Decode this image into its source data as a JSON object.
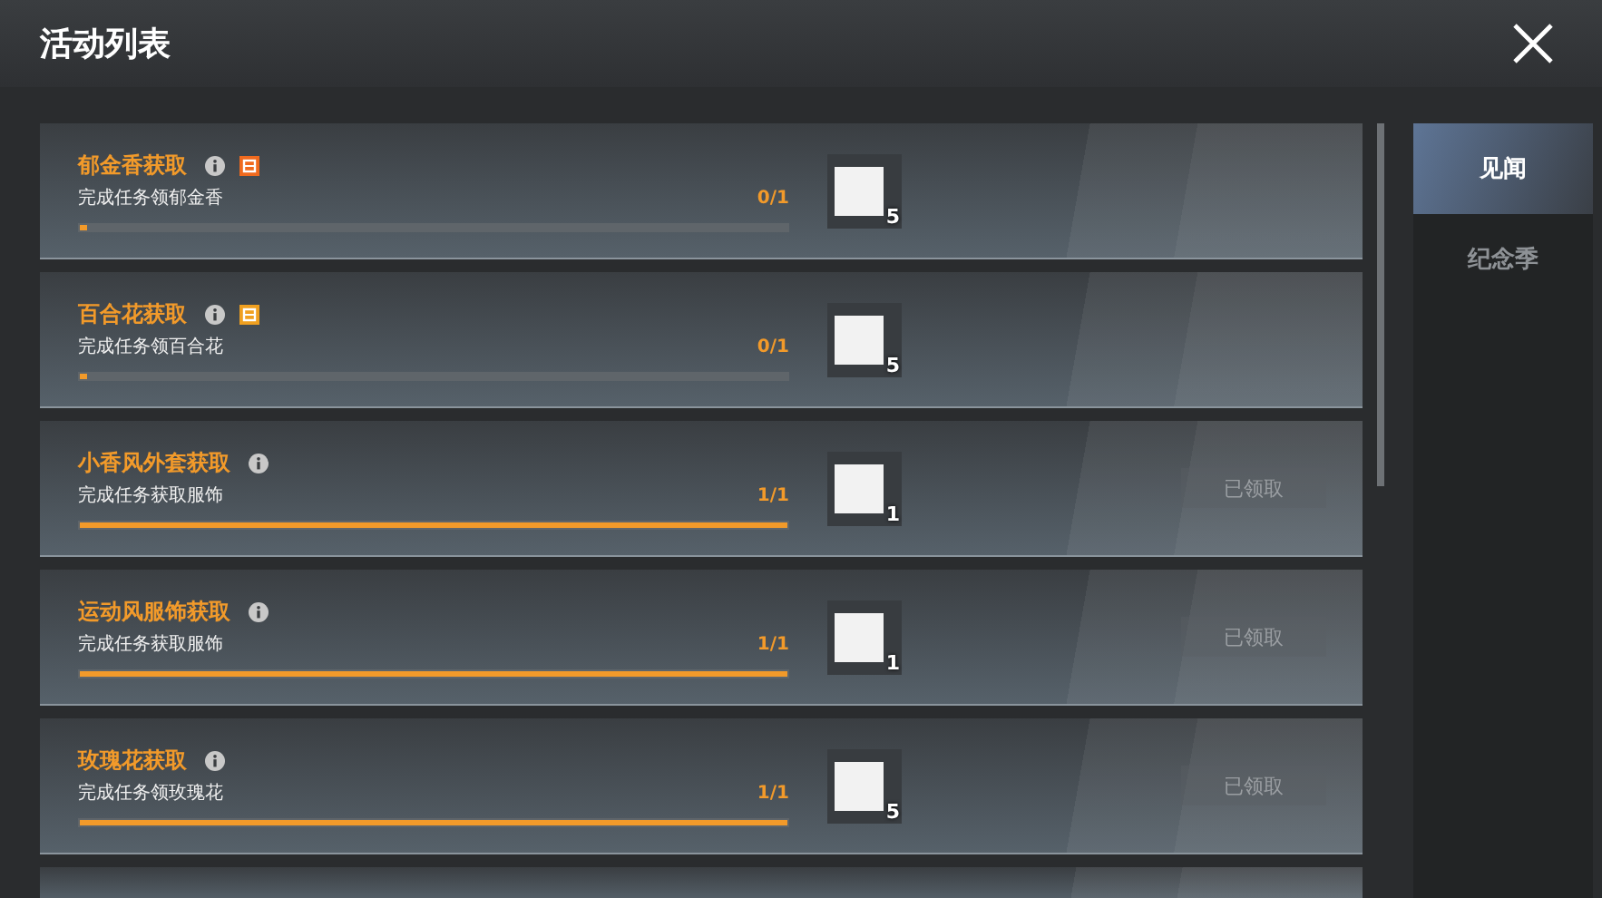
{
  "window": {
    "title": "活动列表"
  },
  "tasks": [
    {
      "title": "郁金香获取",
      "badge": {
        "color": "#f06a1e"
      },
      "description": "完成任务领郁金香",
      "progress": "0/1",
      "level": 0.01,
      "reward_count": "5"
    },
    {
      "title": "百合花获取",
      "badge": {
        "color": "#f0a020"
      },
      "description": "完成任务领百合花",
      "progress": "0/1",
      "level": 0.01,
      "reward_count": "5"
    },
    {
      "title": "小香风外套获取",
      "description": "完成任务获取服饰",
      "progress": "1/1",
      "level": 1,
      "reward_count": "1",
      "button": {
        "label": "已领取",
        "disabled": true
      }
    },
    {
      "title": "运动风服饰获取",
      "description": "完成任务获取服饰",
      "progress": "1/1",
      "level": 1,
      "reward_count": "1",
      "button": {
        "label": "已领取",
        "disabled": true
      }
    },
    {
      "title": "玫瑰花获取",
      "description": "完成任务领玫瑰花",
      "progress": "1/1",
      "level": 1,
      "reward_count": "5",
      "button": {
        "label": "已领取",
        "disabled": true
      }
    }
  ],
  "tabs": [
    {
      "label": "见闻",
      "selected": true
    },
    {
      "label": "纪念季",
      "selected": false
    }
  ]
}
